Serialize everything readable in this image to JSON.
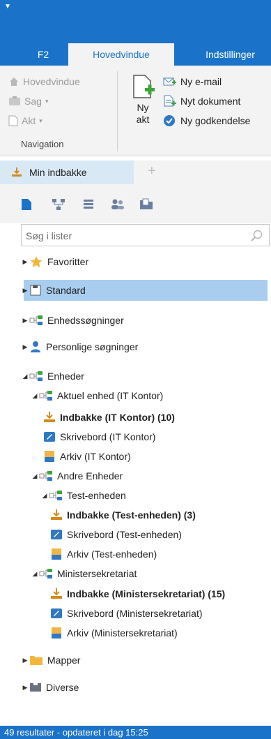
{
  "tabs": {
    "f2": "F2",
    "main": "Hovedvindue",
    "settings": "Indstillinger"
  },
  "ribbon": {
    "main_window": "Hovedvindue",
    "case": "Sag",
    "record": "Akt",
    "new_record_line1": "Ny",
    "new_record_line2": "akt",
    "new_email": "Ny e-mail",
    "new_document": "Nyt dokument",
    "new_approval": "Ny godkendelse",
    "group_label": "Navigation"
  },
  "doc_tab": {
    "label": "Min indbakke"
  },
  "search": {
    "placeholder": "Søg i lister"
  },
  "tree": {
    "favorites": "Favoritter",
    "standard": "Standard",
    "unit_searches": "Enhedssøgninger",
    "personal_searches": "Personlige søgninger",
    "units": "Enheder",
    "current_unit": "Aktuel enhed (IT Kontor)",
    "inbox_it": "Indbakke (IT Kontor) (10)",
    "desk_it": "Skrivebord (IT Kontor)",
    "archive_it": "Arkiv (IT Kontor)",
    "other_units": "Andre Enheder",
    "test_unit": "Test-enheden",
    "inbox_test": "Indbakke (Test-enheden) (3)",
    "desk_test": "Skrivebord (Test-enheden)",
    "archive_test": "Arkiv (Test-enheden)",
    "ministry": "Ministersekretariat",
    "inbox_min": "Indbakke (Ministersekretariat) (15)",
    "desk_min": "Skrivebord (Ministersekretariat)",
    "archive_min": "Arkiv (Ministersekretariat)",
    "folders": "Mapper",
    "misc": "Diverse"
  },
  "status": "49 resultater - opdateret i dag 15:25",
  "colors": {
    "accent": "#1a73c8",
    "selection": "#a9cdee",
    "tab_bg": "#d9e8f5"
  }
}
